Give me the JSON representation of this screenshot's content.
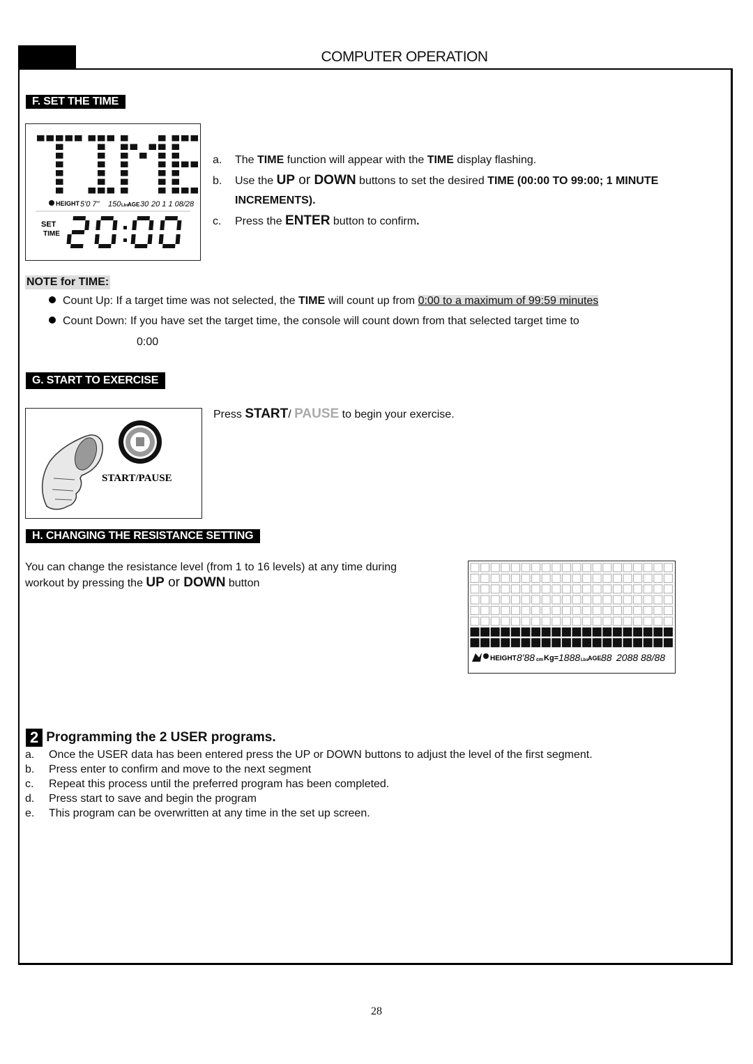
{
  "header": {
    "title": "COMPUTER OPERATION"
  },
  "section_f": {
    "heading": "F. SET THE TIME",
    "lcd": {
      "big_text": "TIME",
      "info_height_label": "HEIGHT",
      "info_height_value": "5'0 7\"",
      "info_weight_value": "150",
      "info_weight_unit": "Lbs",
      "info_age_label": "AGE",
      "info_age_value": "30",
      "info_date": "20 1 1 08/28",
      "set_label": "SET",
      "time_label": "TIME",
      "time_value": "20:00"
    },
    "steps": [
      {
        "label": "a.",
        "parts": [
          {
            "t": "The ",
            "s": "n"
          },
          {
            "t": "TIME",
            "s": "b"
          },
          {
            "t": " function will appear with the ",
            "s": "n"
          },
          {
            "t": "TIME",
            "s": "b"
          },
          {
            "t": " display flashing.",
            "s": "n"
          }
        ]
      },
      {
        "label": "b.",
        "parts": [
          {
            "t": "Use the ",
            "s": "n"
          },
          {
            "t": "UP",
            "s": "big"
          },
          {
            "t": " or ",
            "s": "bigr"
          },
          {
            "t": "DOWN",
            "s": "big"
          },
          {
            "t": " buttons to set the desired ",
            "s": "n"
          },
          {
            "t": "TIME (00:00  TO 99:00;  1 MINUTE",
            "s": "b"
          }
        ]
      },
      {
        "label": "",
        "parts": [
          {
            "t": "INCREMENTS).",
            "s": "b"
          }
        ]
      },
      {
        "label": "c.",
        "parts": [
          {
            "t": "Press the ",
            "s": "n"
          },
          {
            "t": "ENTER",
            "s": "big"
          },
          {
            "t": " button to confirm",
            "s": "n"
          },
          {
            "t": ".",
            "s": "b"
          }
        ]
      }
    ]
  },
  "note_time": {
    "title": "NOTE for TIME:",
    "count_up": {
      "prefix": "Count Up: If a target time was not selected, the ",
      "bold": "TIME",
      "middle": " will count up from ",
      "highlight": "0:00 to a maximum of 99:59 minutes"
    },
    "count_down": {
      "text": "Count Down:  If you have  set the target time, the console will count down  from that selected target time to",
      "continuation": "0:00"
    }
  },
  "section_g": {
    "heading": "G. START TO EXERCISE",
    "button_label": "START/PAUSE",
    "instruction": {
      "prefix": "Press ",
      "start": "START",
      "slash": "/ ",
      "pause": "PAUSE",
      "suffix": " to begin your exercise."
    }
  },
  "section_h": {
    "heading": "H. CHANGING  THE RESISTANCE  SETTING",
    "line1": "You can change  the resistance level  (from 1 to 16 levels)  at any time during",
    "line2_prefix": "workout by pressing the ",
    "up": "UP",
    "or": " or ",
    "down": "DOWN",
    "line2_suffix": " button",
    "lcd": {
      "columns": 20,
      "rows": 8,
      "filled_rows": 2,
      "height_label": "HEIGHT",
      "height_value": "8'88",
      "height_unit": "cm",
      "kg_label": "Kg=",
      "weight_value": "1888",
      "weight_unit": "Lbs",
      "age_label": "AGE",
      "age_value": "88",
      "year_value": "2088",
      "date_value": "88/88"
    }
  },
  "section_2": {
    "number": "2",
    "title": "Programming the 2 USER programs.",
    "steps": [
      {
        "label": "a.",
        "text": "Once the USER data has been entered press the UP or DOWN buttons to adjust the level of the first segment."
      },
      {
        "label": "b.",
        "text": "Press enter to confirm and move to the next segment"
      },
      {
        "label": "c.",
        "text": "Repeat this process until the preferred program has been completed."
      },
      {
        "label": "d.",
        "text": "Press start to save and begin the program"
      },
      {
        "label": "e.",
        "text": "This program can be overwritten at any time in the set up screen."
      }
    ]
  },
  "footer": {
    "page_number": "28"
  }
}
